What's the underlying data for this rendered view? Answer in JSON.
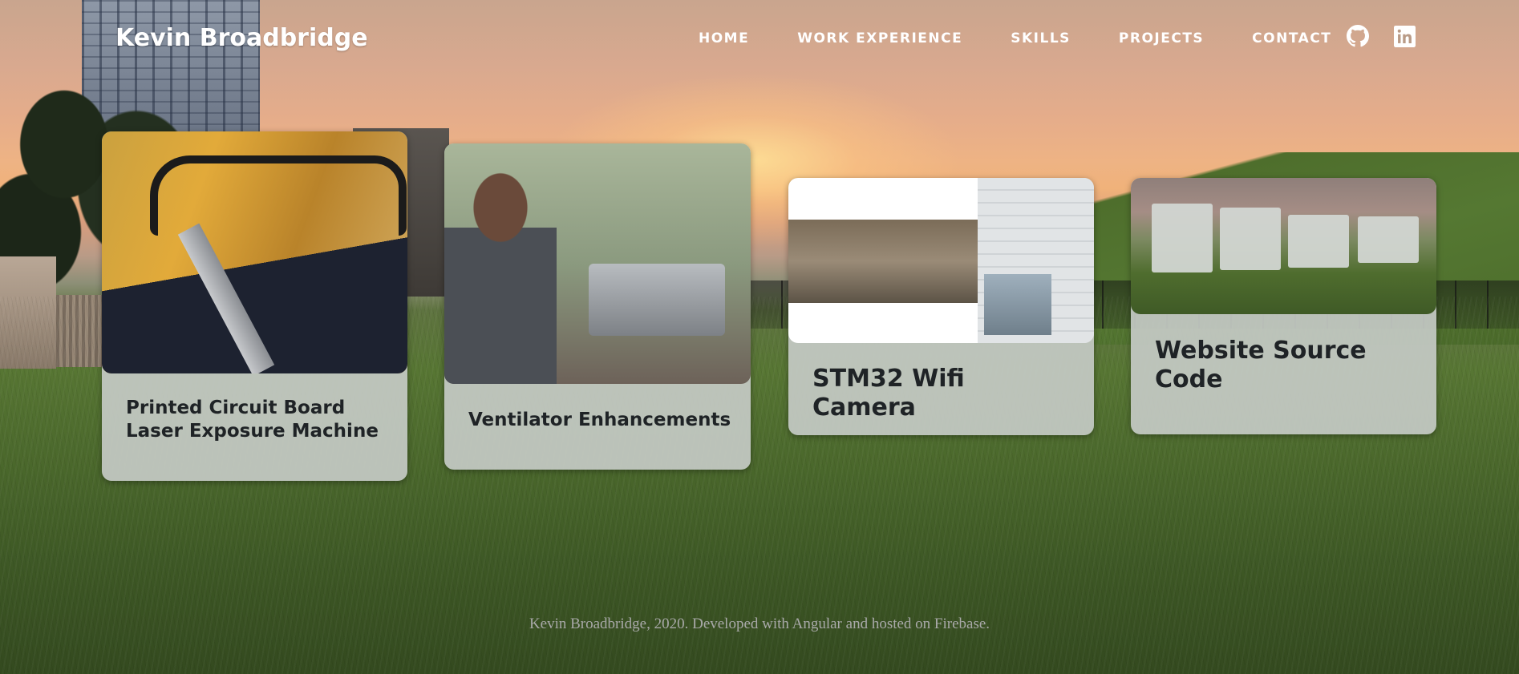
{
  "brand": "Kevin Broadbridge",
  "nav": {
    "items": [
      "HOME",
      "WORK EXPERIENCE",
      "SKILLS",
      "PROJECTS",
      "CONTACT"
    ]
  },
  "social": {
    "github_icon": "github-icon",
    "linkedin_icon": "linkedin-icon"
  },
  "projects": [
    {
      "title": "Printed Circuit Board Laser Exposure Machine",
      "image": "laser-exposure-machine-photo"
    },
    {
      "title": "Ventilator Enhancements",
      "image": "ventilator-photo"
    },
    {
      "title": "STM32 Wifi Camera",
      "image": "wifi-camera-photo"
    },
    {
      "title": "Website Source Code",
      "image": "website-screenshot"
    }
  ],
  "footer": "Kevin Broadbridge, 2020. Developed with Angular and hosted on Firebase."
}
